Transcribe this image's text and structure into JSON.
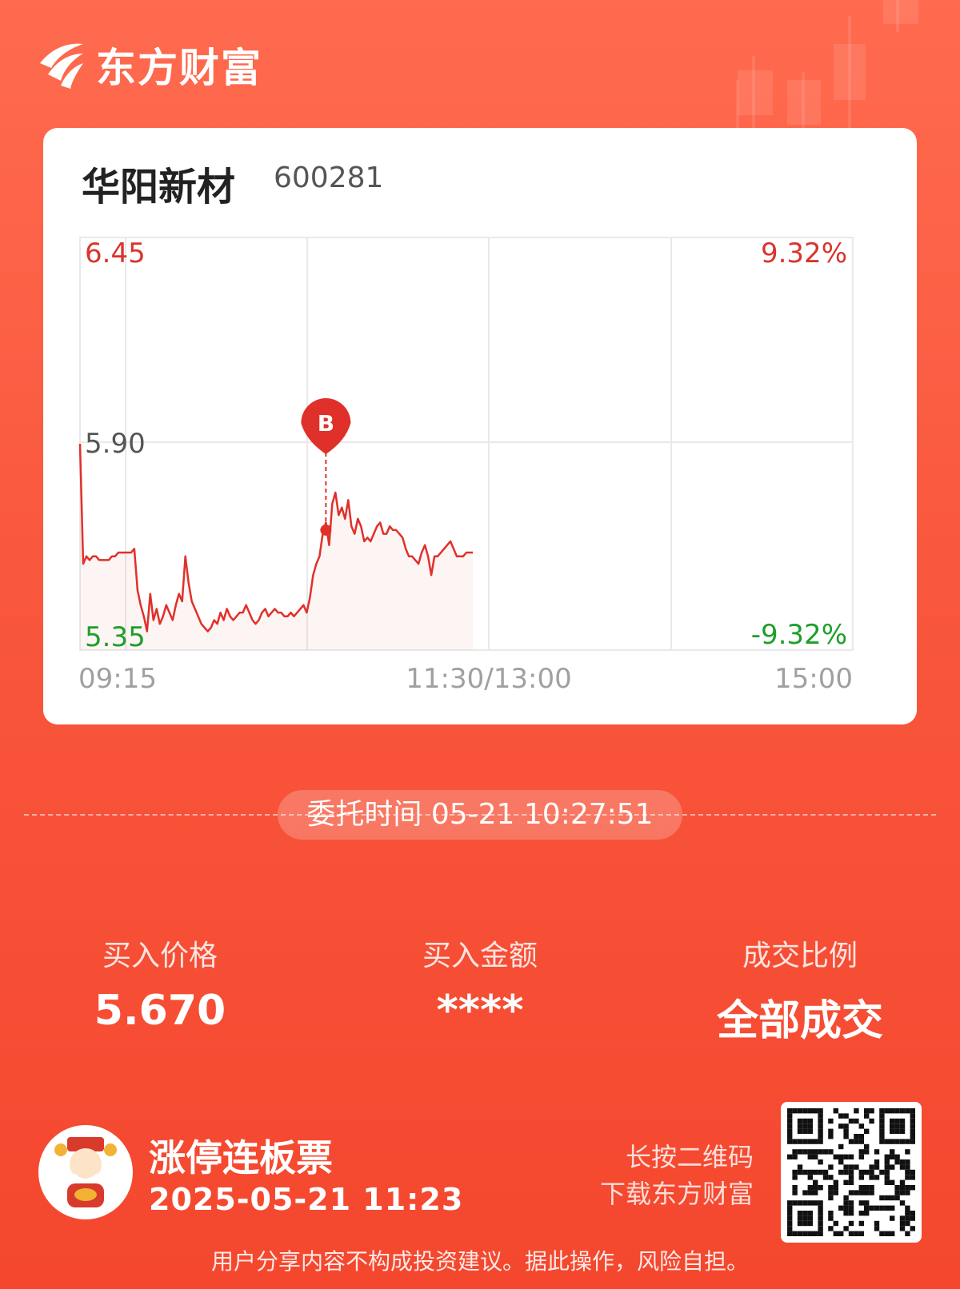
{
  "app": {
    "logo_text": "东方财富"
  },
  "stock": {
    "name": "华阳新材",
    "code": "600281"
  },
  "chart_data": {
    "type": "line",
    "x_tick_labels": [
      "09:15",
      "11:30/13:00",
      "15:00"
    ],
    "y_left_labels": {
      "top": "6.45",
      "mid": "5.90",
      "bottom": "5.35"
    },
    "y_right_labels": {
      "top": "9.32%",
      "bottom": "-9.32%"
    },
    "ylim": [
      5.35,
      6.45
    ],
    "ref_price": 5.9,
    "buy_marker": {
      "label": "B",
      "time_index": 77,
      "price": 5.67
    },
    "series": [
      {
        "values": [
          5.9,
          5.58,
          5.6,
          5.59,
          5.6,
          5.6,
          5.59,
          5.59,
          5.59,
          5.59,
          5.6,
          5.6,
          5.61,
          5.61,
          5.61,
          5.61,
          5.61,
          5.62,
          5.51,
          5.47,
          5.44,
          5.4,
          5.5,
          5.43,
          5.46,
          5.42,
          5.44,
          5.47,
          5.45,
          5.43,
          5.47,
          5.5,
          5.48,
          5.6,
          5.53,
          5.48,
          5.46,
          5.44,
          5.42,
          5.41,
          5.4,
          5.41,
          5.43,
          5.42,
          5.45,
          5.43,
          5.46,
          5.44,
          5.43,
          5.44,
          5.45,
          5.45,
          5.47,
          5.45,
          5.43,
          5.42,
          5.43,
          5.45,
          5.46,
          5.44,
          5.45,
          5.46,
          5.45,
          5.45,
          5.44,
          5.44,
          5.45,
          5.44,
          5.45,
          5.46,
          5.47,
          5.45,
          5.49,
          5.55,
          5.58,
          5.6,
          5.66,
          5.69,
          5.63,
          5.74,
          5.77,
          5.71,
          5.73,
          5.7,
          5.75,
          5.68,
          5.66,
          5.7,
          5.68,
          5.64,
          5.65,
          5.64,
          5.66,
          5.68,
          5.69,
          5.66,
          5.66,
          5.68,
          5.67,
          5.67,
          5.66,
          5.65,
          5.62,
          5.6,
          5.6,
          5.59,
          5.58,
          5.61,
          5.63,
          5.6,
          5.55,
          5.6,
          5.6,
          5.61,
          5.62,
          5.63,
          5.64,
          5.62,
          5.6,
          5.6,
          5.6,
          5.61,
          5.61,
          5.61
        ]
      }
    ]
  },
  "order": {
    "time_label": "委托时间 05-21 10:27:51"
  },
  "metrics": [
    {
      "label": "买入价格",
      "value": "5.670"
    },
    {
      "label": "买入金额",
      "value": "****"
    },
    {
      "label": "成交比例",
      "value": "全部成交"
    }
  ],
  "promo": {
    "title": "涨停连板票",
    "datetime": "2025-05-21 11:23"
  },
  "qr_hint": {
    "line1": "长按二维码",
    "line2": "下载东方财富"
  },
  "disclaimer": "用户分享内容不构成投资建议。据此操作，风险自担。",
  "colors": {
    "up": "#e0302a",
    "down": "#1e9e2a",
    "background": "#f9573d"
  }
}
